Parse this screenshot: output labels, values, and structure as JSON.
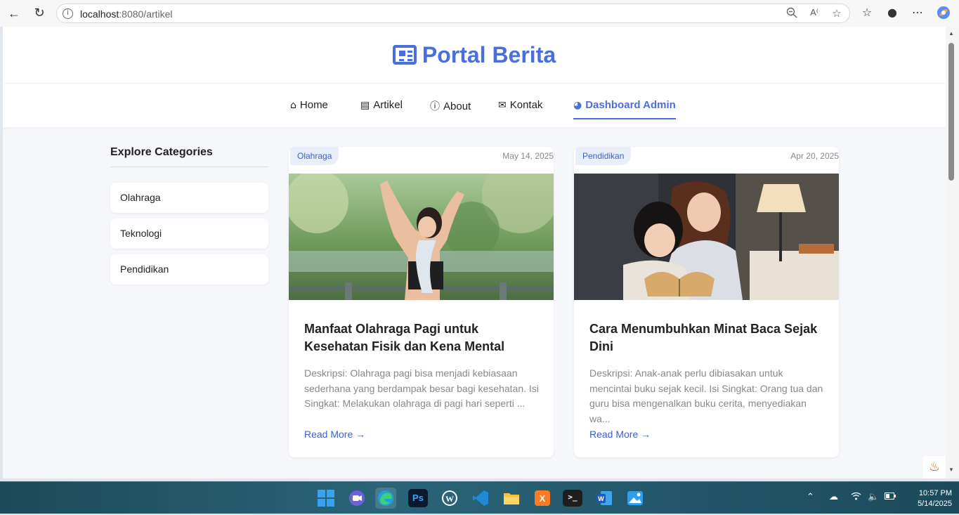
{
  "browser": {
    "url_host": "localhost",
    "url_path": ":8080/artikel"
  },
  "site": {
    "brand": "Portal Berita",
    "nav": [
      {
        "label": "Home",
        "icon": "home-icon"
      },
      {
        "label": "Artikel",
        "icon": "newspaper-icon"
      },
      {
        "label": "About",
        "icon": "info-icon"
      },
      {
        "label": "Kontak",
        "icon": "envelope-icon"
      },
      {
        "label": "Dashboard Admin",
        "icon": "dashboard-icon",
        "active": true
      }
    ]
  },
  "sidebar": {
    "title": "Explore Categories",
    "items": [
      "Olahraga",
      "Teknologi",
      "Pendidikan"
    ]
  },
  "articles": [
    {
      "category": "Olahraga",
      "date": "May 14, 2025",
      "title": "Manfaat Olahraga Pagi untuk Kesehatan Fisik dan Kena Mental",
      "desc": "Deskripsi: Olahraga pagi bisa menjadi kebiasaan sederhana yang berdampak besar bagi kesehatan. Isi Singkat: Melakukan olahraga di pagi hari seperti ...",
      "more": "Read More →"
    },
    {
      "category": "Pendidikan",
      "date": "Apr 20, 2025",
      "title": "Cara Menumbuhkan Minat Baca Sejak Dini",
      "desc": "Deskripsi: Anak-anak perlu dibiasakan untuk mencintai buku sejak kecil. Isi Singkat: Orang tua dan guru bisa mengenalkan buku cerita, menyediakan wa...",
      "more": "Read More →"
    }
  ],
  "taskbar": {
    "time": "10:57 PM",
    "date": "5/14/2025"
  },
  "colors": {
    "accent": "#4a6fdc",
    "page_bg": "#f5f7fa"
  }
}
